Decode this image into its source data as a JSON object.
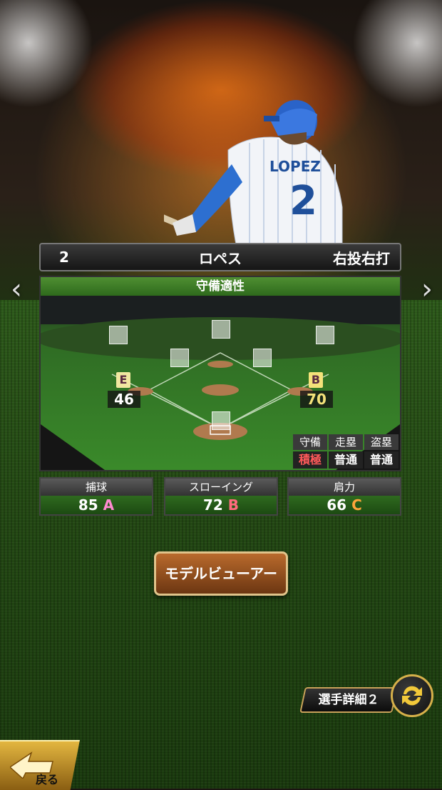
{
  "player": {
    "number": "2",
    "name": "ロペス",
    "throw_bat": "右投右打",
    "uniform_name": "LOPEZ",
    "uniform_number": "2"
  },
  "field": {
    "title": "守備適性",
    "positions": [
      {
        "grade": "E",
        "value": "46",
        "grade_color": "#f1e7a0"
      },
      {
        "grade": "B",
        "value": "70",
        "grade_color": "#f4e27a"
      }
    ],
    "mini_stats": {
      "headers": [
        "守備",
        "走塁",
        "盗塁"
      ],
      "values": [
        "積極",
        "普通",
        "普通"
      ]
    }
  },
  "stats": [
    {
      "label": "捕球",
      "value": "85",
      "grade": "A"
    },
    {
      "label": "スローイング",
      "value": "72",
      "grade": "B"
    },
    {
      "label": "肩力",
      "value": "66",
      "grade": "C"
    }
  ],
  "buttons": {
    "model_viewer": "モデルビューアー",
    "player_detail": "選手詳細２",
    "back": "戻る"
  },
  "icons": {
    "prev": "chevron-left-icon",
    "next": "chevron-right-icon",
    "swap": "swap-icon"
  }
}
